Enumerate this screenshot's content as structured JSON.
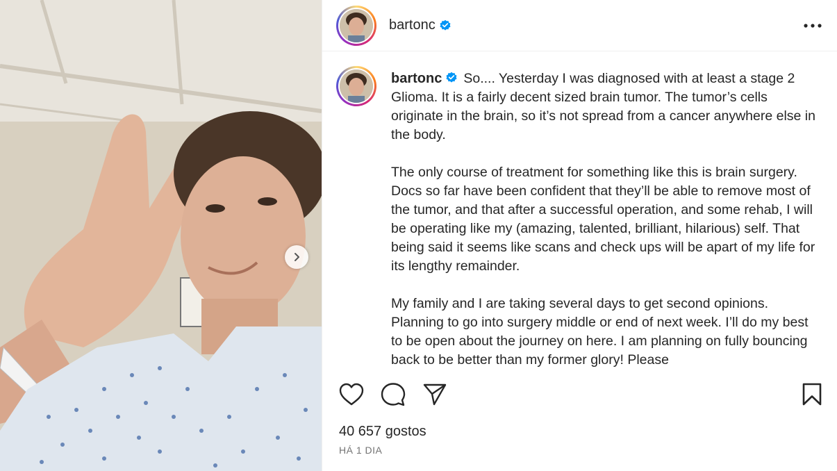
{
  "post": {
    "username": "bartonc",
    "verified": true,
    "more_icon": "more-horizontal-icon"
  },
  "caption": {
    "username": "bartonc",
    "paragraphs": [
      "So.... Yesterday I was diagnosed with at least a stage 2 Glioma. It is a fairly decent sized brain tumor. The tumor’s cells originate in the brain, so it’s not spread from a cancer anywhere else in the body.",
      "The only course of treatment for something like this is brain surgery. Docs so far have been confident that they’ll be able to remove most of the tumor, and that after a successful operation, and some rehab, I will be operating like my (amazing, talented, brilliant, hilarious) self. That being said it seems like scans and check ups will be apart of my life for its lengthy remainder.",
      "My family and I are taking several days to get second opinions. Planning to go into surgery middle or end of next week. I’ll do my best to be open about the journey on here. I am planning on fully bouncing back to be better than my former glory! Please"
    ]
  },
  "actions": {
    "like_icon": "heart-icon",
    "comment_icon": "comment-icon",
    "share_icon": "send-icon",
    "save_icon": "bookmark-icon"
  },
  "stats": {
    "likes": "40 657 gostos",
    "time": "HÁ 1 DIA"
  },
  "media": {
    "next_icon": "chevron-right-icon",
    "image_description": "hospital selfie"
  },
  "colors": {
    "verified_blue": "#0095f6",
    "text": "#262626",
    "muted": "#737373"
  }
}
